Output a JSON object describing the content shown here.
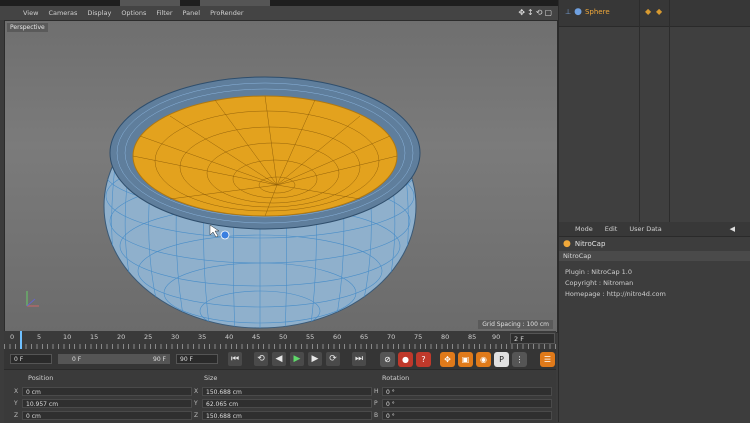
{
  "viewport_menu": [
    "View",
    "Cameras",
    "Display",
    "Options",
    "Filter",
    "Panel",
    "ProRender"
  ],
  "viewport": {
    "label": "Perspective",
    "grid_spacing": "Grid Spacing : 100 cm"
  },
  "object_manager": {
    "object_name": "Sphere"
  },
  "attribute_manager": {
    "menu": [
      "Mode",
      "Edit",
      "User Data"
    ],
    "title": "NitroCap",
    "subtitle": "NitroCap",
    "info": [
      "Plugin : NitroCap 1.0",
      "Copyright : Nitroman",
      "Homepage : http://nitro4d.com"
    ]
  },
  "timeline": {
    "ticks": [
      "0",
      "5",
      "10",
      "15",
      "20",
      "25",
      "30",
      "35",
      "40",
      "45",
      "50",
      "55",
      "60",
      "65",
      "70",
      "75",
      "80",
      "85",
      "90"
    ],
    "current_frame": "2 F"
  },
  "transport": {
    "start": "0 F",
    "min": "0 F",
    "max": "90 F",
    "end": "90 F"
  },
  "coords": {
    "headers": [
      "Position",
      "Size",
      "Rotation"
    ],
    "position": [
      "0 cm",
      "10.957 cm",
      "0 cm"
    ],
    "size": [
      "150.688 cm",
      "62.065 cm",
      "150.688 cm"
    ],
    "rotation": [
      "0 °",
      "0 °",
      "0 °"
    ],
    "pos_labels": [
      "X",
      "Y",
      "Z"
    ],
    "size_labels": [
      "X",
      "Y",
      "Z"
    ],
    "rot_labels": [
      "H",
      "P",
      "B"
    ]
  },
  "colors": {
    "accent": "#f0a83a",
    "mesh_blue": "#4a90c8",
    "mesh_orange": "#e8a020"
  }
}
